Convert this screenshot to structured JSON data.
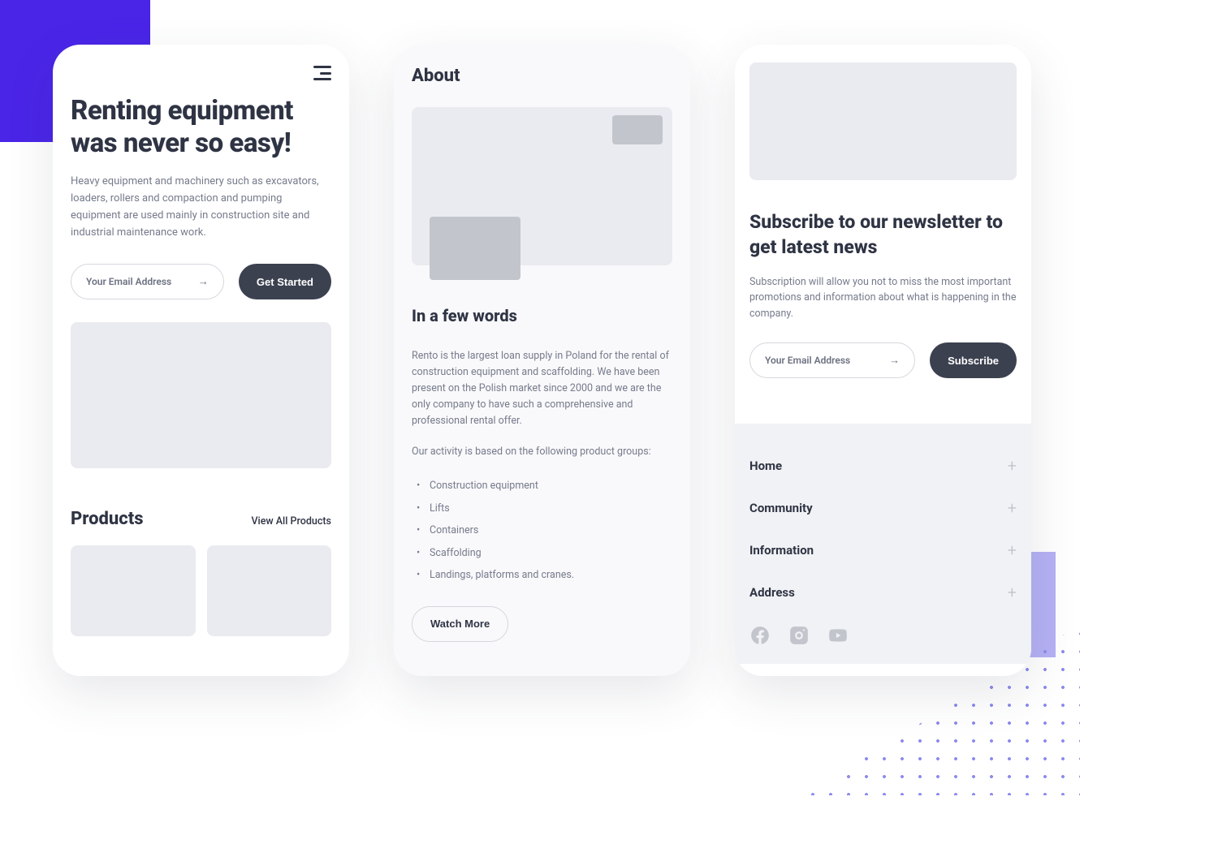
{
  "screen1": {
    "hero_title": "Renting equipment was never so easy!",
    "hero_desc": "Heavy equipment and machinery such as excavators, loaders, rollers and compaction and pumping equipment are used mainly in construction site and industrial maintenance work.",
    "email_placeholder": "Your Email Address",
    "get_started": "Get Started",
    "products_title": "Products",
    "view_all": "View All Products"
  },
  "screen2": {
    "about_title": "About",
    "subheading": "In a few words",
    "para1": "Rento is the largest loan supply in Poland for the rental of construction equipment and scaffolding. We have been present on the Polish market since 2000 and we are the only company to have such a comprehensive and professional rental offer.",
    "para2": "Our activity is based on the following product groups:",
    "list": [
      "Construction equipment",
      "Lifts",
      "Containers",
      "Scaffolding",
      "Landings, platforms and cranes."
    ],
    "watch_more": "Watch More"
  },
  "screen3": {
    "news_title": "Subscribe to our newsletter to get latest news",
    "news_desc": "Subscription will allow you not to miss the most important promotions and information about what is happening in the company.",
    "email_placeholder": "Your Email Address",
    "subscribe": "Subscribe",
    "footer_items": [
      "Home",
      "Community",
      "Information",
      "Address"
    ]
  }
}
